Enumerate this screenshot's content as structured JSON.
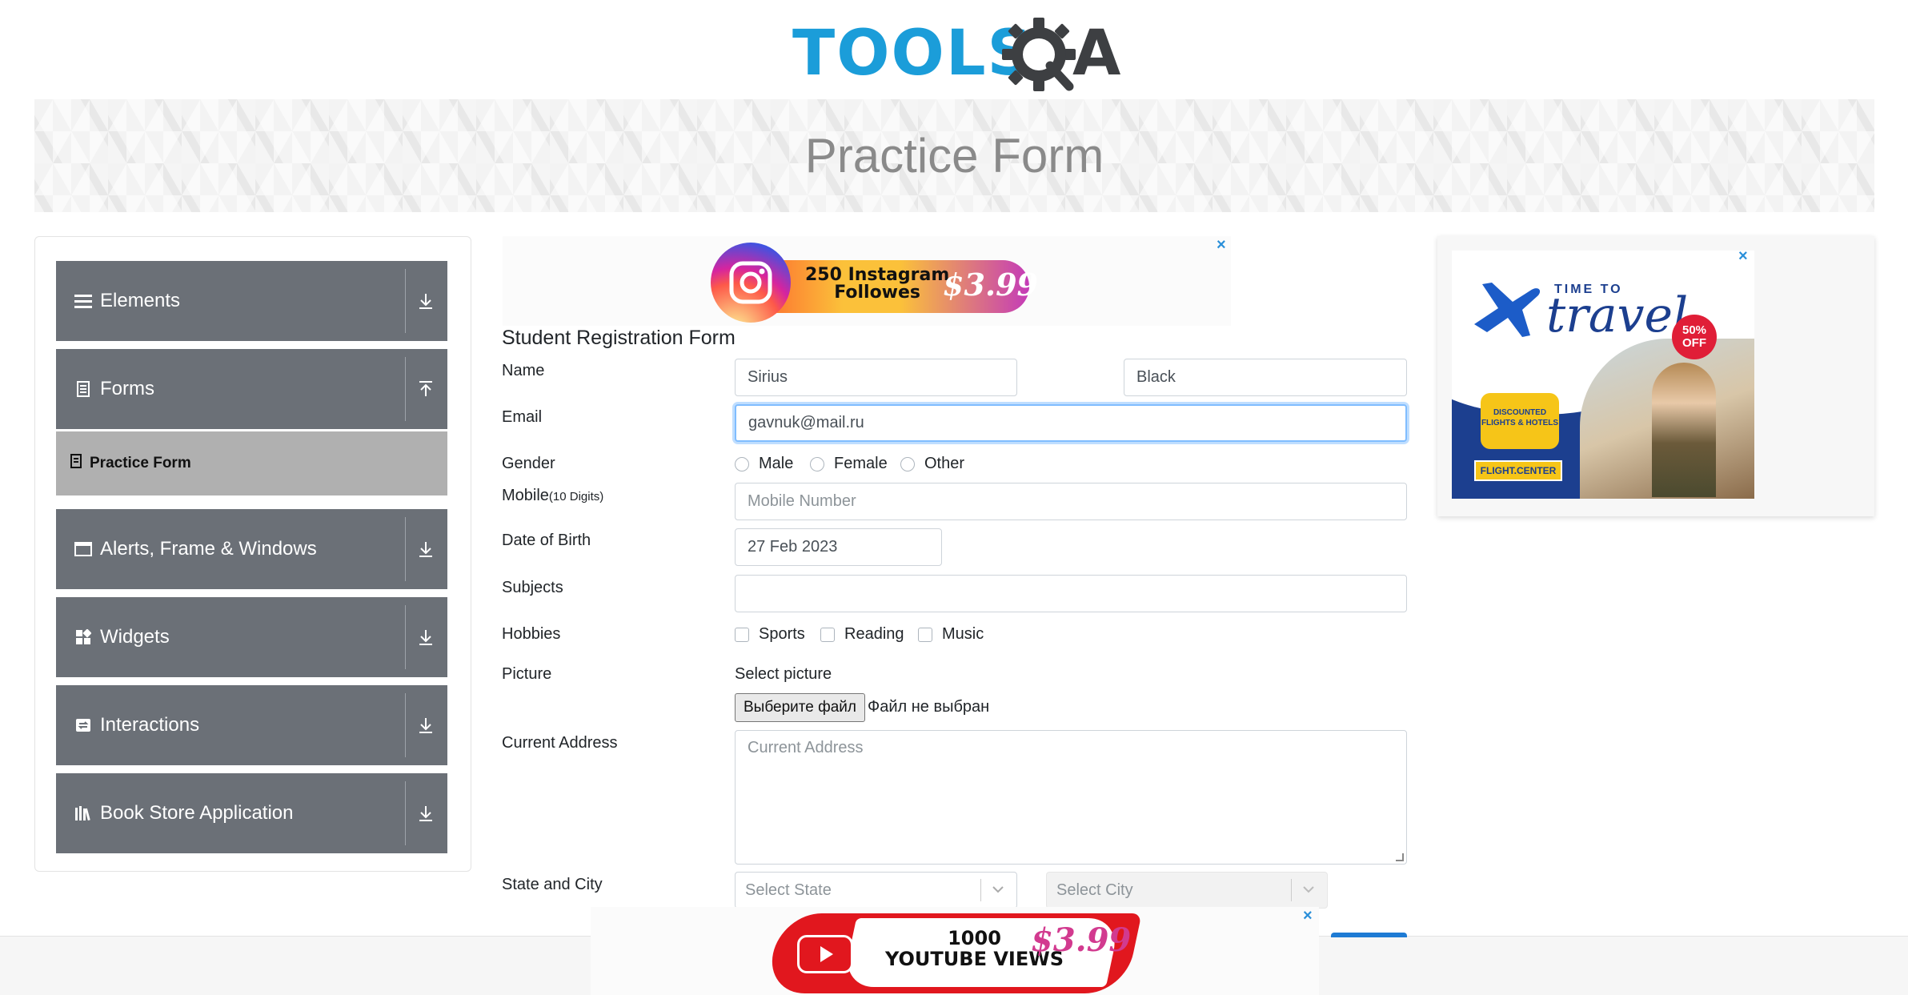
{
  "header": {
    "logo_text": "TOOLS",
    "logo_tail": "A"
  },
  "banner": {
    "title": "Practice Form"
  },
  "sidebar": {
    "groups": [
      {
        "label": "Elements",
        "icon": "menu-icon",
        "state": "collapsed"
      },
      {
        "label": "Forms",
        "icon": "document-icon",
        "state": "expanded"
      },
      {
        "label": "Alerts, Frame & Windows",
        "icon": "window-icon",
        "state": "collapsed"
      },
      {
        "label": "Widgets",
        "icon": "widgets-icon",
        "state": "collapsed"
      },
      {
        "label": "Interactions",
        "icon": "interactions-icon",
        "state": "collapsed"
      },
      {
        "label": "Book Store Application",
        "icon": "books-icon",
        "state": "collapsed"
      }
    ],
    "active_item": "Practice Form"
  },
  "ads": {
    "top": {
      "line1": "250 Instagram",
      "line2": "Followes",
      "price": "$3.99",
      "close": "×"
    },
    "right": {
      "time_to": "TIME TO",
      "word": "travel",
      "badge1": "50%",
      "badge2": "OFF",
      "bubble1": "DISCOUNTED",
      "bubble2": "FLIGHTS & HOTELS",
      "brand": "FLIGHT.CENTER",
      "close": "×"
    },
    "bottom": {
      "line1": "1000",
      "line2": "YOUTUBE VIEWS",
      "price": "$3.99",
      "close": "×"
    }
  },
  "form": {
    "title": "Student Registration Form",
    "labels": {
      "name": "Name",
      "email": "Email",
      "gender": "Gender",
      "mobile": "Mobile",
      "mobile_hint": "(10 Digits)",
      "dob": "Date of Birth",
      "subjects": "Subjects",
      "hobbies": "Hobbies",
      "picture": "Picture",
      "address": "Current Address",
      "state_city": "State and City"
    },
    "first_name": "Sirius",
    "last_name": "Black",
    "email": "gavnuk@mail.ru",
    "gender_options": [
      "Male",
      "Female",
      "Other"
    ],
    "mobile_placeholder": "Mobile Number",
    "dob": "27 Feb 2023",
    "subjects": "",
    "hobbies": [
      "Sports",
      "Reading",
      "Music"
    ],
    "picture_label": "Select picture",
    "file_button": "Выберите файл",
    "file_status": "Файл не выбран",
    "address_placeholder": "Current Address",
    "state_placeholder": "Select State",
    "city_placeholder": "Select City"
  },
  "colors": {
    "brand_blue": "#1b9dd9",
    "sidebar_group": "#6b7077",
    "sidebar_active": "#b0b0b0",
    "focus_border": "#80bdff"
  }
}
